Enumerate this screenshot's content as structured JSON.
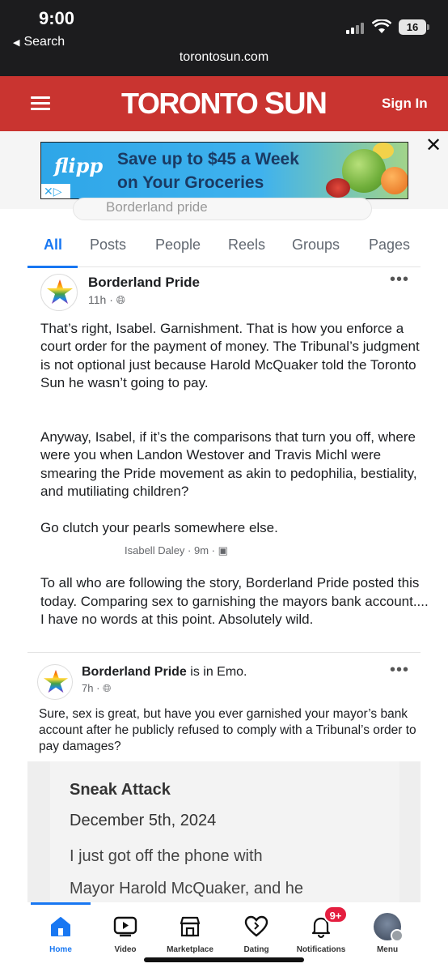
{
  "status_bar": {
    "time": "9:00",
    "back_label": "Search",
    "battery": "16"
  },
  "browser": {
    "url": "torontosun.com"
  },
  "site_header": {
    "brand_part1": "TORONTO",
    "brand_part2": "SUN",
    "sign_in": "Sign In"
  },
  "ad": {
    "logo": "flipp",
    "line1": "Save up to $45 a Week",
    "line2": "on Your Groceries",
    "close_glyph": "✕"
  },
  "fb": {
    "search_value": "Borderland pride",
    "tabs": [
      {
        "label": "All"
      },
      {
        "label": "Posts"
      },
      {
        "label": "People"
      },
      {
        "label": "Reels"
      },
      {
        "label": "Groups"
      },
      {
        "label": "Pages"
      }
    ],
    "post1": {
      "author": "Borderland Pride",
      "time": "11h · ",
      "para1": "That’s right, Isabel. Garnishment. That is how you enforce a court order for the payment of money. The Tribunal’s judgment is not optional just because Harold McQuaker told the Toronto Sun he wasn’t going to pay.",
      "para2": "Anyway, Isabel, if it’s the comparisons that turn you off, where were you when Landon Westover and Travis Michl were smearing the Pride movement as akin to pedophilia, bestiality, and mutiliating children?",
      "para3": "Go clutch your pearls somewhere else."
    },
    "comment": {
      "author": "Isabell Daley",
      "time": "9m",
      "text": "To all who are following the story, Borderland Pride posted this today. Comparing sex to garnishing the mayors bank account.... I have no words at this point. Absolutely wild."
    },
    "post2": {
      "author": "Borderland Pride",
      "author_suffix": " is in Emo.",
      "time": "7h · ",
      "text": "Sure, sex is great, but have you ever garnished your mayor’s bank account after he publicly refused to comply with a Tribunal’s order to pay damages?",
      "quote_title": "Sneak Attack",
      "quote_date": "December 5th, 2024",
      "quote_line1": "I just got off the phone with",
      "quote_line2": "Mayor Harold McQuaker, and he"
    },
    "nav": [
      {
        "label": "Home"
      },
      {
        "label": "Video"
      },
      {
        "label": "Marketplace"
      },
      {
        "label": "Dating"
      },
      {
        "label": "Notifications",
        "badge": "9+"
      },
      {
        "label": "Menu"
      }
    ]
  },
  "colors": {
    "sun_red": "#c93430",
    "fb_blue": "#1877f2",
    "ad_blue": "#2ea6e8",
    "badge_red": "#e41e3f"
  }
}
